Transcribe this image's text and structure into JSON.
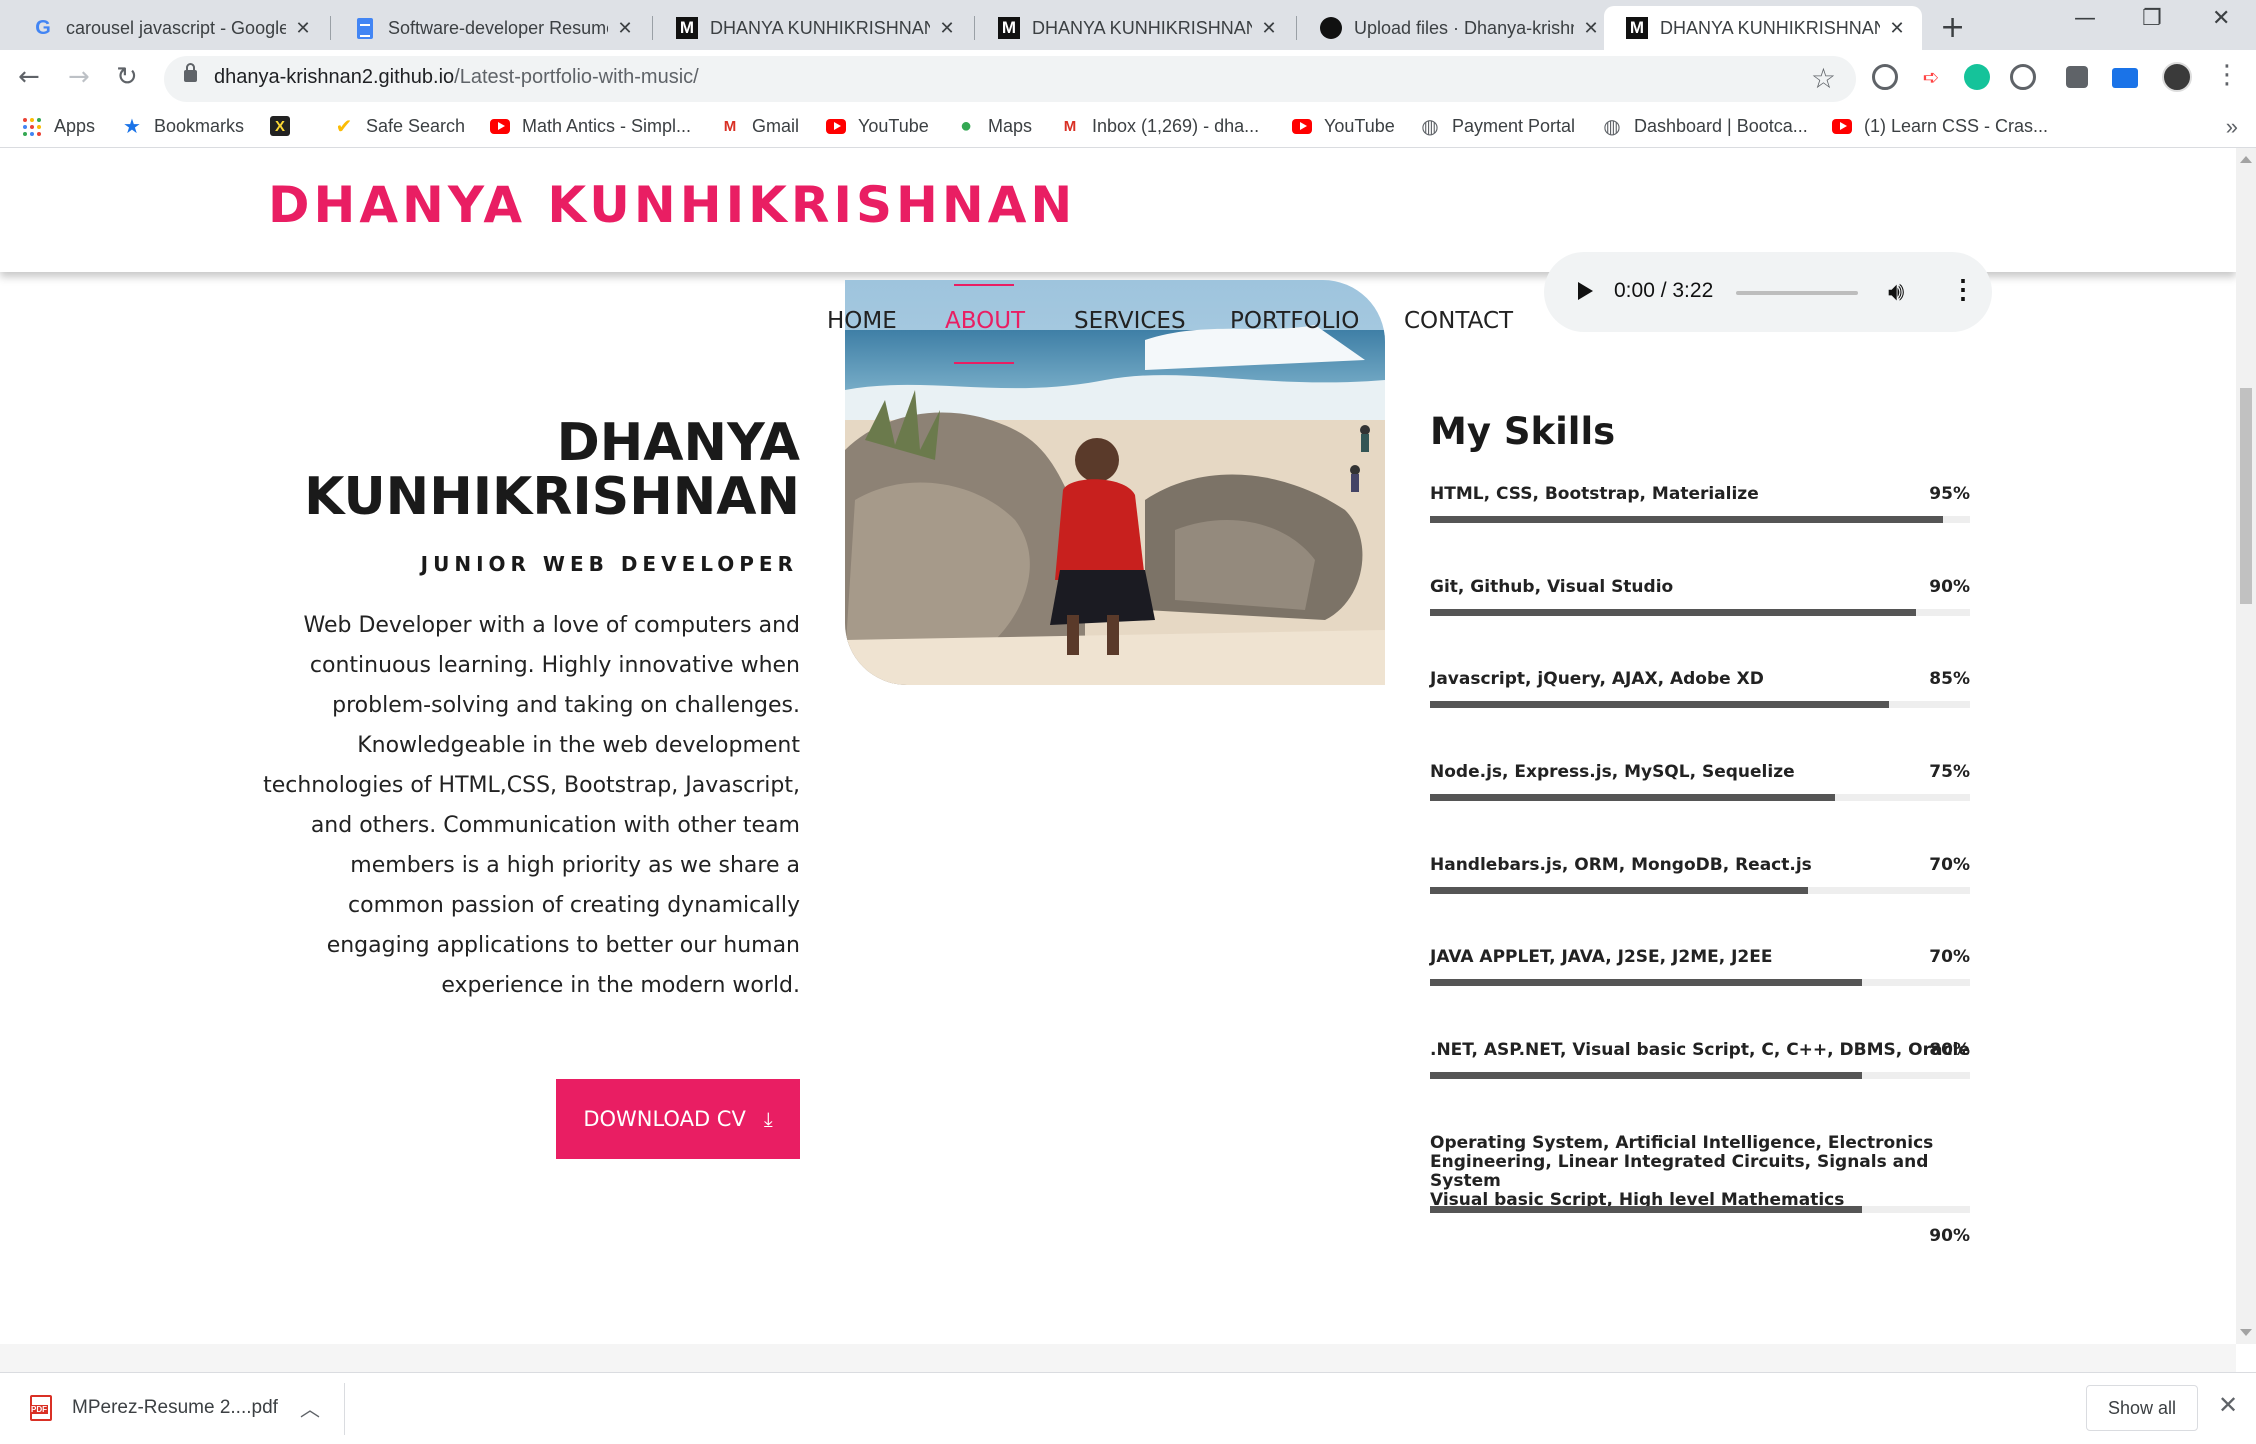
{
  "browser": {
    "tabs": [
      {
        "title": "carousel javascript - Google",
        "favicon": "google-icon"
      },
      {
        "title": "Software-developer Resume",
        "favicon": "docs-icon"
      },
      {
        "title": "DHANYA KUNHIKRISHNAN",
        "favicon": "m-icon"
      },
      {
        "title": "DHANYA KUNHIKRISHNAN",
        "favicon": "m-icon"
      },
      {
        "title": "Upload files · Dhanya-krishn",
        "favicon": "github-icon"
      },
      {
        "title": "DHANYA KUNHIKRISHNAN",
        "favicon": "m-icon",
        "active": true
      }
    ],
    "url_host": "dhanya-krishnan2.github.io",
    "url_path": "/Latest-portfolio-with-music/",
    "bookmarks": [
      {
        "label": "Apps",
        "icon": "apps-grid-icon"
      },
      {
        "label": "Bookmarks",
        "icon": "star-icon"
      },
      {
        "label": "",
        "icon": "x-app-icon"
      },
      {
        "label": "Safe Search",
        "icon": "safe-search-icon"
      },
      {
        "label": "Math Antics - Simpl...",
        "icon": "youtube-icon"
      },
      {
        "label": "Gmail",
        "icon": "gmail-icon"
      },
      {
        "label": "YouTube",
        "icon": "youtube-icon"
      },
      {
        "label": "Maps",
        "icon": "maps-icon"
      },
      {
        "label": "Inbox (1,269) - dha...",
        "icon": "gmail-icon"
      },
      {
        "label": "YouTube",
        "icon": "youtube-icon"
      },
      {
        "label": "Payment Portal",
        "icon": "globe-icon"
      },
      {
        "label": "Dashboard | Bootca...",
        "icon": "globe-icon"
      },
      {
        "label": "(1) Learn CSS - Cras...",
        "icon": "youtube-icon"
      }
    ]
  },
  "site": {
    "brand": "DHANYA KUNHIKRISHNAN",
    "accent_color": "#e91e63",
    "nav": [
      "HOME",
      "ABOUT",
      "SERVICES",
      "PORTFOLIO",
      "CONTACT"
    ],
    "nav_active": "ABOUT",
    "player": {
      "time": "0:00 / 3:22",
      "progress": 0
    }
  },
  "about": {
    "name_line1": "DHANYA",
    "name_line2": "KUNHIKRISHNAN",
    "role": "JUNIOR WEB DEVELOPER",
    "bio_lines": [
      "Web Developer with a love of computers and",
      "continuous learning. Highly innovative when",
      "problem-solving and taking on challenges.",
      "Knowledgeable in the web development",
      "technologies of HTML,CSS, Bootstrap, Javascript,",
      "and others. Communication with other team",
      "members is a high priority as we share a",
      "common passion of creating dynamically",
      "engaging applications to better our human",
      "experience in the modern world."
    ],
    "cv_button": "DOWNLOAD CV"
  },
  "skills": {
    "title": "My Skills",
    "items": [
      {
        "name": "HTML, CSS, Bootstrap, Materialize",
        "pct": "95%",
        "fill": 0.95
      },
      {
        "name": "Git, Github, Visual Studio",
        "pct": "90%",
        "fill": 0.9
      },
      {
        "name": "Javascript, jQuery, AJAX, Adobe XD",
        "pct": "85%",
        "fill": 0.85
      },
      {
        "name": "Node.js, Express.js, MySQL, Sequelize",
        "pct": "75%",
        "fill": 0.75
      },
      {
        "name": "Handlebars.js, ORM, MongoDB, React.js",
        "pct": "70%",
        "fill": 0.7
      },
      {
        "name": "JAVA APPLET, JAVA, J2SE, J2ME, J2EE",
        "pct": "70%",
        "fill": 0.8
      },
      {
        "name": ".NET, ASP.NET, Visual basic Script, C, C++, DBMS, Oracle",
        "pct": "80%",
        "fill": 0.8
      },
      {
        "name_lines": [
          "Operating System, Artificial Intelligence, Electronics",
          "Engineering, Linear Integrated Circuits, Signals and System",
          "Visual basic Script, High level Mathematics"
        ],
        "pct": "90%",
        "fill": 0.8
      }
    ]
  },
  "downloads": {
    "file": "MPerez-Resume 2....pdf",
    "show_all": "Show all"
  }
}
